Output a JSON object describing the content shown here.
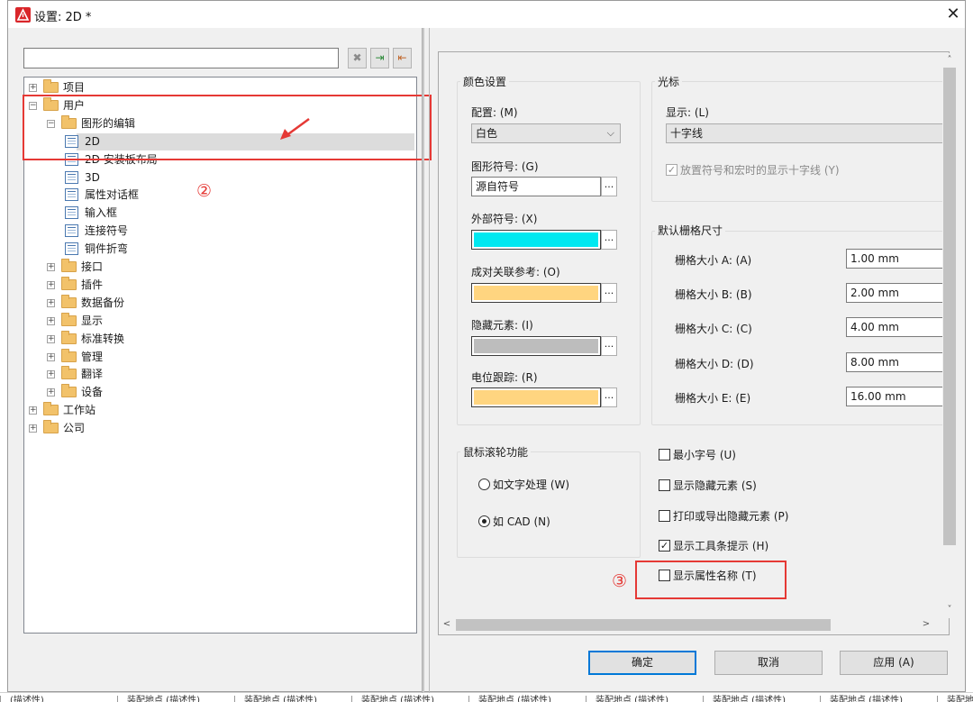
{
  "window": {
    "title": "设置: 2D *",
    "close": "✕"
  },
  "left": {
    "search": {
      "value": ""
    },
    "toolbar": {
      "clear": "✖",
      "import": "⇥",
      "export": "⇤"
    },
    "tree": [
      {
        "label": "项目",
        "type": "folder",
        "exp": "+"
      },
      {
        "label": "用户",
        "type": "folder",
        "exp": "−"
      },
      {
        "label": "图形的编辑",
        "type": "folder",
        "exp": "−"
      },
      {
        "label": "2D",
        "type": "page"
      },
      {
        "label": "2D 安装板布局",
        "type": "page"
      },
      {
        "label": "3D",
        "type": "page"
      },
      {
        "label": "属性对话框",
        "type": "page"
      },
      {
        "label": "输入框",
        "type": "page"
      },
      {
        "label": "连接符号",
        "type": "page"
      },
      {
        "label": "铜件折弯",
        "type": "page"
      },
      {
        "label": "接口",
        "type": "folder",
        "exp": "+"
      },
      {
        "label": "插件",
        "type": "folder",
        "exp": "+"
      },
      {
        "label": "数据备份",
        "type": "folder",
        "exp": "+"
      },
      {
        "label": "显示",
        "type": "folder",
        "exp": "+"
      },
      {
        "label": "标准转换",
        "type": "folder",
        "exp": "+"
      },
      {
        "label": "管理",
        "type": "folder",
        "exp": "+"
      },
      {
        "label": "翻译",
        "type": "folder",
        "exp": "+"
      },
      {
        "label": "设备",
        "type": "folder",
        "exp": "+"
      },
      {
        "label": "工作站",
        "type": "folder",
        "exp": "+"
      },
      {
        "label": "公司",
        "type": "folder",
        "exp": "+"
      }
    ]
  },
  "annotations": {
    "n2": "②",
    "n3": "③"
  },
  "color": {
    "title": "颜色设置",
    "config_label": "配置: (M)",
    "config_value": "白色",
    "symbol_label": "图形符号: (G)",
    "symbol_value": "源自符号",
    "external_label": "外部符号: (X)",
    "external_color": "#00e8f0",
    "pair_label": "成对关联参考: (O)",
    "pair_color": "#ffd580",
    "hidden_label": "隐藏元素: (I)",
    "hidden_color": "#bdbdbd",
    "potential_label": "电位跟踪: (R)",
    "potential_color": "#ffd580",
    "ellipsis": "..."
  },
  "cursor": {
    "title": "光标",
    "display_label": "显示: (L)",
    "display_value": "十字线",
    "crosshair_check": "放置符号和宏时的显示十字线 (Y)",
    "crosshair_mark": "✓"
  },
  "grid": {
    "title": "默认栅格尺寸",
    "rows": [
      {
        "label": "栅格大小 A: (A)",
        "value": "1.00 mm"
      },
      {
        "label": "栅格大小 B: (B)",
        "value": "2.00 mm"
      },
      {
        "label": "栅格大小 C: (C)",
        "value": "4.00 mm"
      },
      {
        "label": "栅格大小 D: (D)",
        "value": "8.00 mm"
      },
      {
        "label": "栅格大小 E: (E)",
        "value": "16.00 mm"
      }
    ]
  },
  "wheel": {
    "title": "鼠标滚轮功能",
    "opt1": "如文字处理 (W)",
    "opt2": "如 CAD (N)"
  },
  "options": {
    "min_font": "最小字号 (U)",
    "show_hidden": "显示隐藏元素 (S)",
    "print_hidden": "打印或导出隐藏元素 (P)",
    "show_tips": "显示工具条提示 (H)",
    "show_tips_mark": "✓",
    "show_attr": "显示属性名称 (T)"
  },
  "scroll": {
    "up": "˄",
    "down": "˅",
    "left": "<",
    "right": ">"
  },
  "buttons": {
    "ok": "确定",
    "cancel": "取消",
    "apply": "应用 (A)"
  },
  "background_strip": [
    "(描述性)",
    "装配地点 (描述性)",
    "装配地点 (描述性)",
    "装配地点 (描述性)",
    "装配地点 (描述性)",
    "装配地点 (描述性)",
    "装配地点 (描述性)",
    "装配地点 (描述性)",
    "装配地点 (描述性)"
  ]
}
